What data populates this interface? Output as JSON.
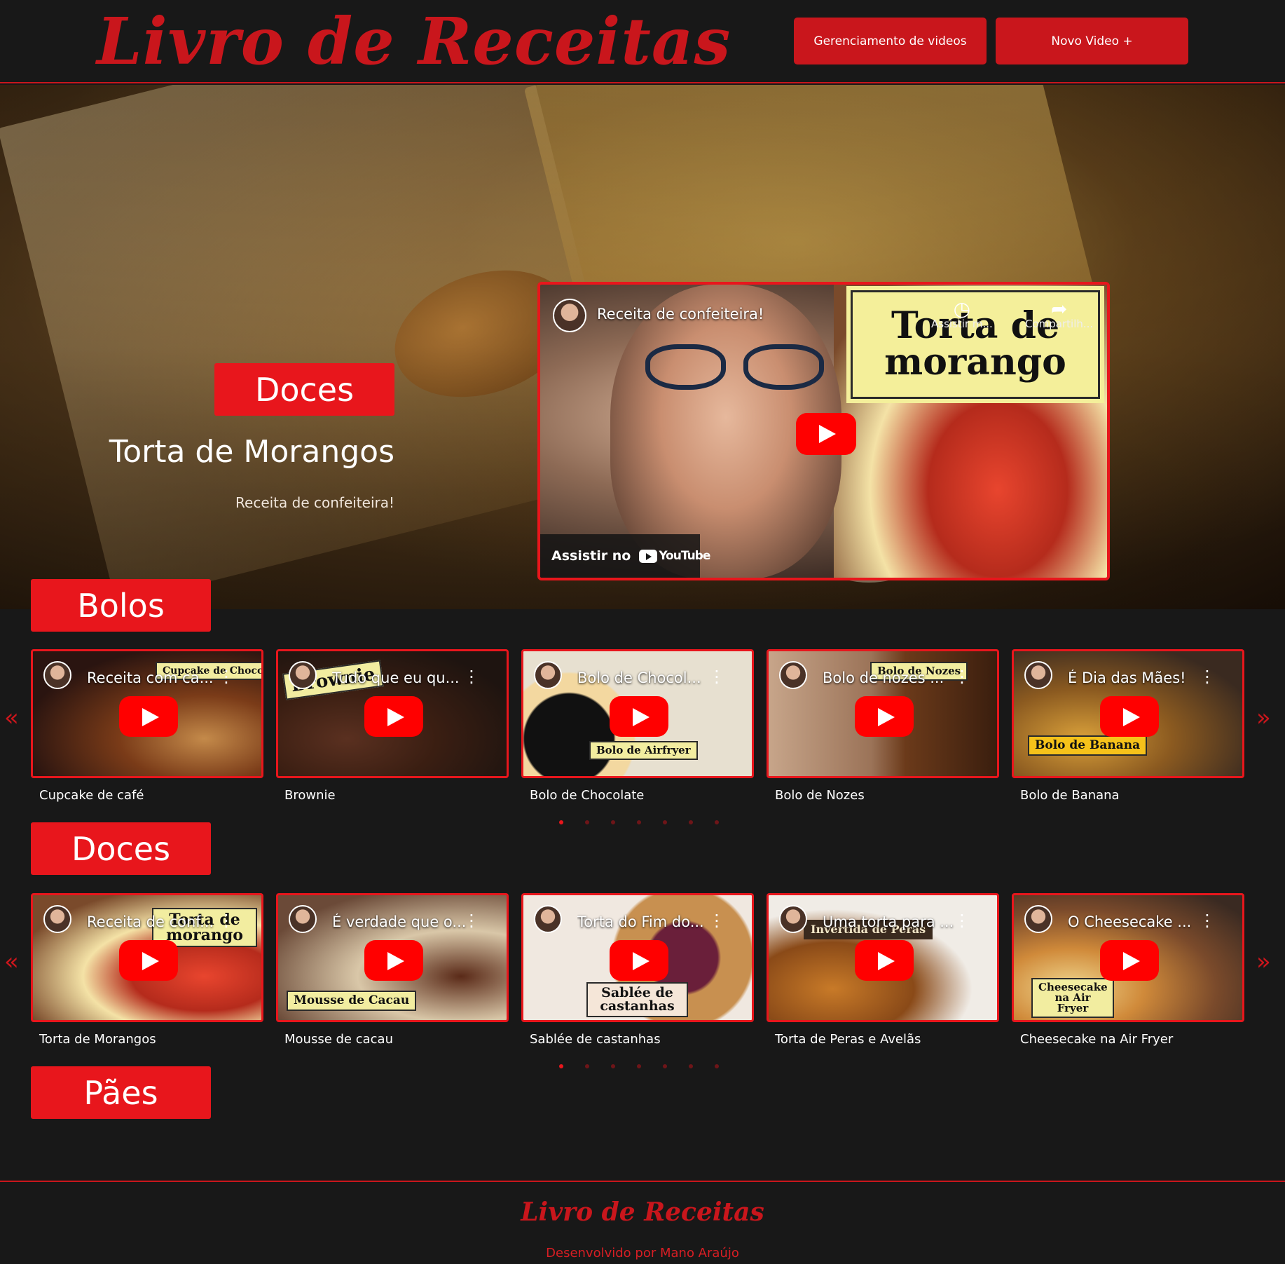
{
  "header": {
    "logo": "Livro de Receitas",
    "btn_manage": "Gerenciamento de videos",
    "btn_new": "Novo Video +"
  },
  "hero": {
    "category": "Doces",
    "title": "Torta de Morangos",
    "subtitle": "Receita de confeiteira!",
    "video": {
      "title": "Receita de confeiteira!",
      "overlay_text": "Torta de morango",
      "watch_later": "Assistir m...",
      "share": "Compartilh...",
      "watch_on": "Assistir no",
      "platform": "YouTube"
    }
  },
  "sections": [
    {
      "label": "Bolos",
      "videos": [
        {
          "video_title": "Receita com ca...",
          "overlay": "Cupcake de Chocolate",
          "caption": "Cupcake de café"
        },
        {
          "video_title": "Tudo que eu qu...",
          "overlay": "Brownie",
          "caption": "Brownie"
        },
        {
          "video_title": "Bolo de Chocol...",
          "overlay": "Bolo de Airfryer",
          "caption": "Bolo de Chocolate"
        },
        {
          "video_title": "Bolo de nozes ...",
          "overlay": "Bolo de Nozes",
          "caption": "Bolo de Nozes"
        },
        {
          "video_title": "É Dia das Mães!",
          "overlay": "Bolo de Banana",
          "caption": "Bolo de Banana"
        }
      ],
      "dots": 7,
      "active_dot": 1
    },
    {
      "label": "Doces",
      "videos": [
        {
          "video_title": "Receita de conf...",
          "overlay": "Torta de morango",
          "caption": "Torta de Morangos"
        },
        {
          "video_title": "É verdade que o...",
          "overlay": "Mousse de Cacau",
          "caption": "Mousse de cacau"
        },
        {
          "video_title": "Torta do Fim do...",
          "overlay": "Sablée de castanhas",
          "caption": "Sablée de castanhas"
        },
        {
          "video_title": "Uma torta para ...",
          "overlay": "Invertida de Peras",
          "caption": "Torta de Peras e Avelãs"
        },
        {
          "video_title": "O Cheesecake ...",
          "overlay": "Cheesecake na Air Fryer",
          "caption": "Cheesecake na Air Fryer"
        }
      ],
      "dots": 7,
      "active_dot": 1
    },
    {
      "label": "Pães",
      "videos": []
    }
  ],
  "carousel": {
    "prev": "«",
    "next": "»"
  },
  "footer": {
    "logo": "Livro de Receitas",
    "credit": "Desenvolvido por Mano Araújo"
  },
  "colors": {
    "accent": "#e8161c",
    "dark_accent": "#c9161c",
    "background": "#181818"
  },
  "icons": [
    "play-icon",
    "clock-icon",
    "share-icon",
    "more-vert-icon",
    "chevron-left-icon",
    "chevron-right-icon",
    "youtube-logo-icon"
  ]
}
